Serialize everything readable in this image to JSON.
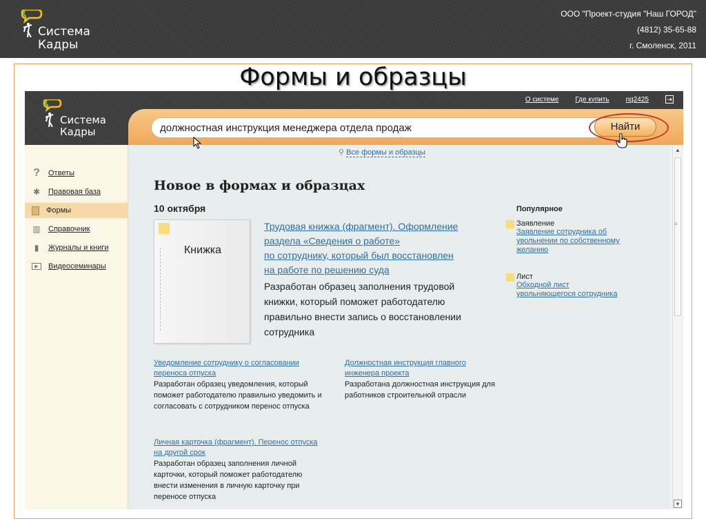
{
  "slide": {
    "logo_line1": "Система",
    "logo_line2": "Кадры",
    "company": "ООО \"Проект-студия \"Наш ГОРОД\"",
    "phone": "(4812) 35-65-88",
    "city": "г. Смоленск, 2011",
    "title": "Формы и образцы"
  },
  "app": {
    "logo_line1": "Система",
    "logo_line2": "Кадры",
    "links": [
      "О системе",
      "Где купить",
      "nq2425"
    ],
    "search_value": "должностная инструкция менеджера отдела продаж",
    "search_button": "Найти",
    "all_forms": "Все формы и образцы"
  },
  "sidebar": {
    "items": [
      {
        "label": "Ответы",
        "icon": "question-icon"
      },
      {
        "label": "Правовая база",
        "icon": "emblem-icon"
      },
      {
        "label": "Формы",
        "icon": "form-icon",
        "active": true
      },
      {
        "label": "Справочник",
        "icon": "book-icon"
      },
      {
        "label": "Журналы и книги",
        "icon": "journals-icon"
      },
      {
        "label": "Видеосеминары",
        "icon": "video-icon"
      }
    ]
  },
  "main": {
    "heading": "Новое в формах и образцах",
    "date": "10 октября",
    "book_label": "Книжка",
    "feature_link": [
      "Трудовая книжка (фрагмент). Оформление",
      "раздела «Сведения о работе»",
      "по сотруднику, который был восстановлен",
      "на работе по решению суда"
    ],
    "feature_desc": "Разработан образец заполнения трудовой книжки, который поможет работодателю правильно внести запись о восстановлении сотрудника",
    "cards": [
      {
        "link": "Уведомление сотруднику о согласовании переноса отпуска",
        "desc": "Разработан образец уведомления, который поможет работодателю правильно уведомить и согласовать с сотрудником перенос отпуска"
      },
      {
        "link": "Должностная инструкция главного инженера проекта",
        "desc": "Разработана должностная инструкция для работников строительной отрасли"
      },
      {
        "link": "Личная карточка (фрагмент). Перенос отпуска на другой срок",
        "desc": "Разработан образец заполнения личной карточки, который поможет работодателю внести изменения в личную карточку при переносе отпуска"
      }
    ]
  },
  "popular": {
    "title": "Популярное",
    "items": [
      {
        "title": "Заявление",
        "link": "Заявление сотрудника об увольнении по собственному желанию"
      },
      {
        "title": "Лист",
        "link": "Обходной лист увольняющегося сотрудника"
      }
    ]
  },
  "colors": {
    "accent": "#f0a85a",
    "link": "#2f6da1",
    "highlight": "#c0392b"
  }
}
